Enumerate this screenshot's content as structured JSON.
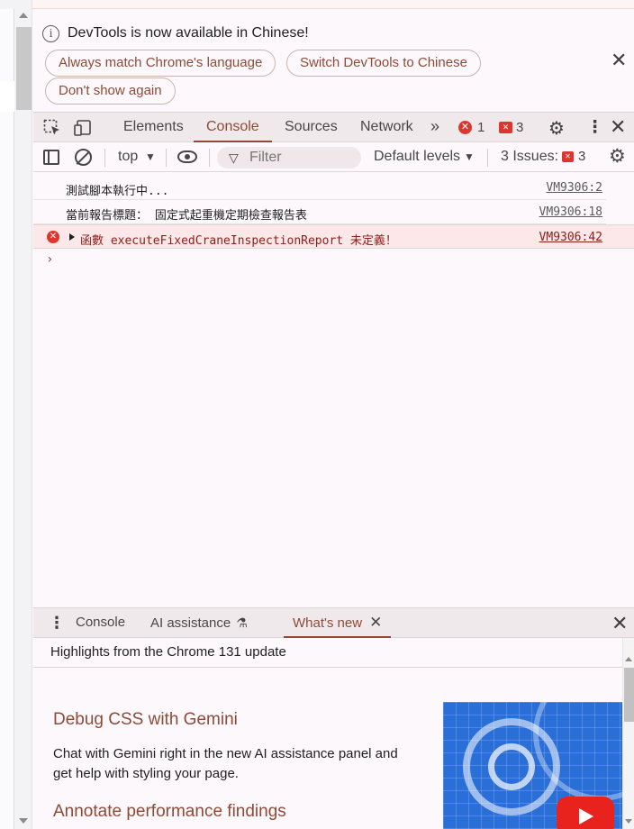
{
  "infobar": {
    "message": "DevTools is now available in Chinese!",
    "buttons": {
      "always_match": "Always match Chrome's language",
      "switch_chinese": "Switch DevTools to Chinese",
      "dont_show": "Don't show again"
    },
    "close_glyph": "✕"
  },
  "main_tabs": {
    "items": [
      "Elements",
      "Console",
      "Sources",
      "Network"
    ],
    "active": "Console",
    "more_glyph": "»",
    "error_count": "1",
    "issue_count": "3"
  },
  "console_toolbar": {
    "context": "top",
    "filter_placeholder": "Filter",
    "levels": "Default levels",
    "issues_label": "3 Issues:",
    "issues_count": "3"
  },
  "messages": [
    {
      "level": "log",
      "text": "測試腳本執行中...",
      "source": "VM9306:2"
    },
    {
      "level": "log",
      "text": "當前報告標題： 固定式起重機定期檢查報告表",
      "source": "VM9306:18"
    },
    {
      "level": "error",
      "text": "函數 executeFixedCraneInspectionReport 未定義！",
      "source": "VM9306:42"
    }
  ],
  "prompt_glyph": "›",
  "drawer": {
    "tabs": [
      "Console",
      "AI assistance",
      "What's new"
    ],
    "active": "What's new",
    "header": "Highlights from the Chrome 131 update",
    "sections": [
      {
        "title": "Debug CSS with Gemini",
        "body": "Chat with Gemini right in the new AI assistance panel and get help with styling your page."
      },
      {
        "title": "Annotate performance findings",
        "body": ""
      }
    ]
  },
  "colors": {
    "accent": "#8f4a37",
    "error": "#dc362e",
    "error_bg": "#fce8e8",
    "tabbar_bg": "#f0e9eb"
  }
}
